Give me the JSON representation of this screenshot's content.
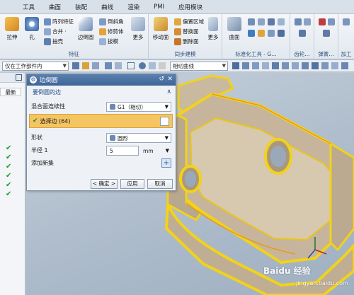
{
  "menu": {
    "items": [
      "工具",
      "曲面",
      "装配",
      "曲线",
      "渲染",
      "PMI",
      "应用模块"
    ]
  },
  "ribbon": {
    "group_feature": {
      "title": "特征",
      "big_buttons": [
        "拉伸",
        "孔"
      ],
      "small_buttons": [
        "阵列特征",
        "合并 ·",
        "抽壳"
      ],
      "edge_blend": "边倒圆",
      "more": "更多",
      "edge_col": [
        "倒斜角",
        "修剪体",
        "拔模"
      ]
    },
    "group_sync": {
      "title": "同步建模",
      "big_button": "移动面",
      "small_buttons": [
        "偏置区域",
        "替换面",
        "删除面"
      ],
      "more": "更多"
    },
    "group_std": {
      "title": "标准化工具 - G…",
      "surface": "曲面"
    },
    "group_gear": {
      "title": "齿轮…"
    },
    "group_spring": {
      "title": "弹簧…"
    },
    "group_process": {
      "title": "加工"
    }
  },
  "toolbar": {
    "filter_value": "仅在工作部件内",
    "curve_rule": "相切曲线"
  },
  "left_panel": {
    "newest_label": "最新",
    "checks": [
      "✔",
      "✔",
      "✔",
      "✔",
      "✔",
      "✔"
    ]
  },
  "dialog": {
    "title": "边倒圆",
    "section_edges": "要倒圆的边",
    "continuity_label": "混合面连续性",
    "continuity_value": "G1（相切）",
    "select_edge": "选择边 (64)",
    "shape_label": "形状",
    "shape_value": "圆形",
    "radius_label": "半径 1",
    "radius_value": "5",
    "radius_unit": "mm",
    "add_new_set": "添加新集",
    "ok": "< 确定 >",
    "apply": "应用",
    "cancel": "取消"
  },
  "watermark": {
    "logo": "Baidu 经验",
    "url": "jingyan.baidu.com"
  },
  "colors": {
    "part_yellow": "#f2d21a",
    "dialog_header": "#3f6597",
    "selection_highlight": "#f5c463"
  }
}
